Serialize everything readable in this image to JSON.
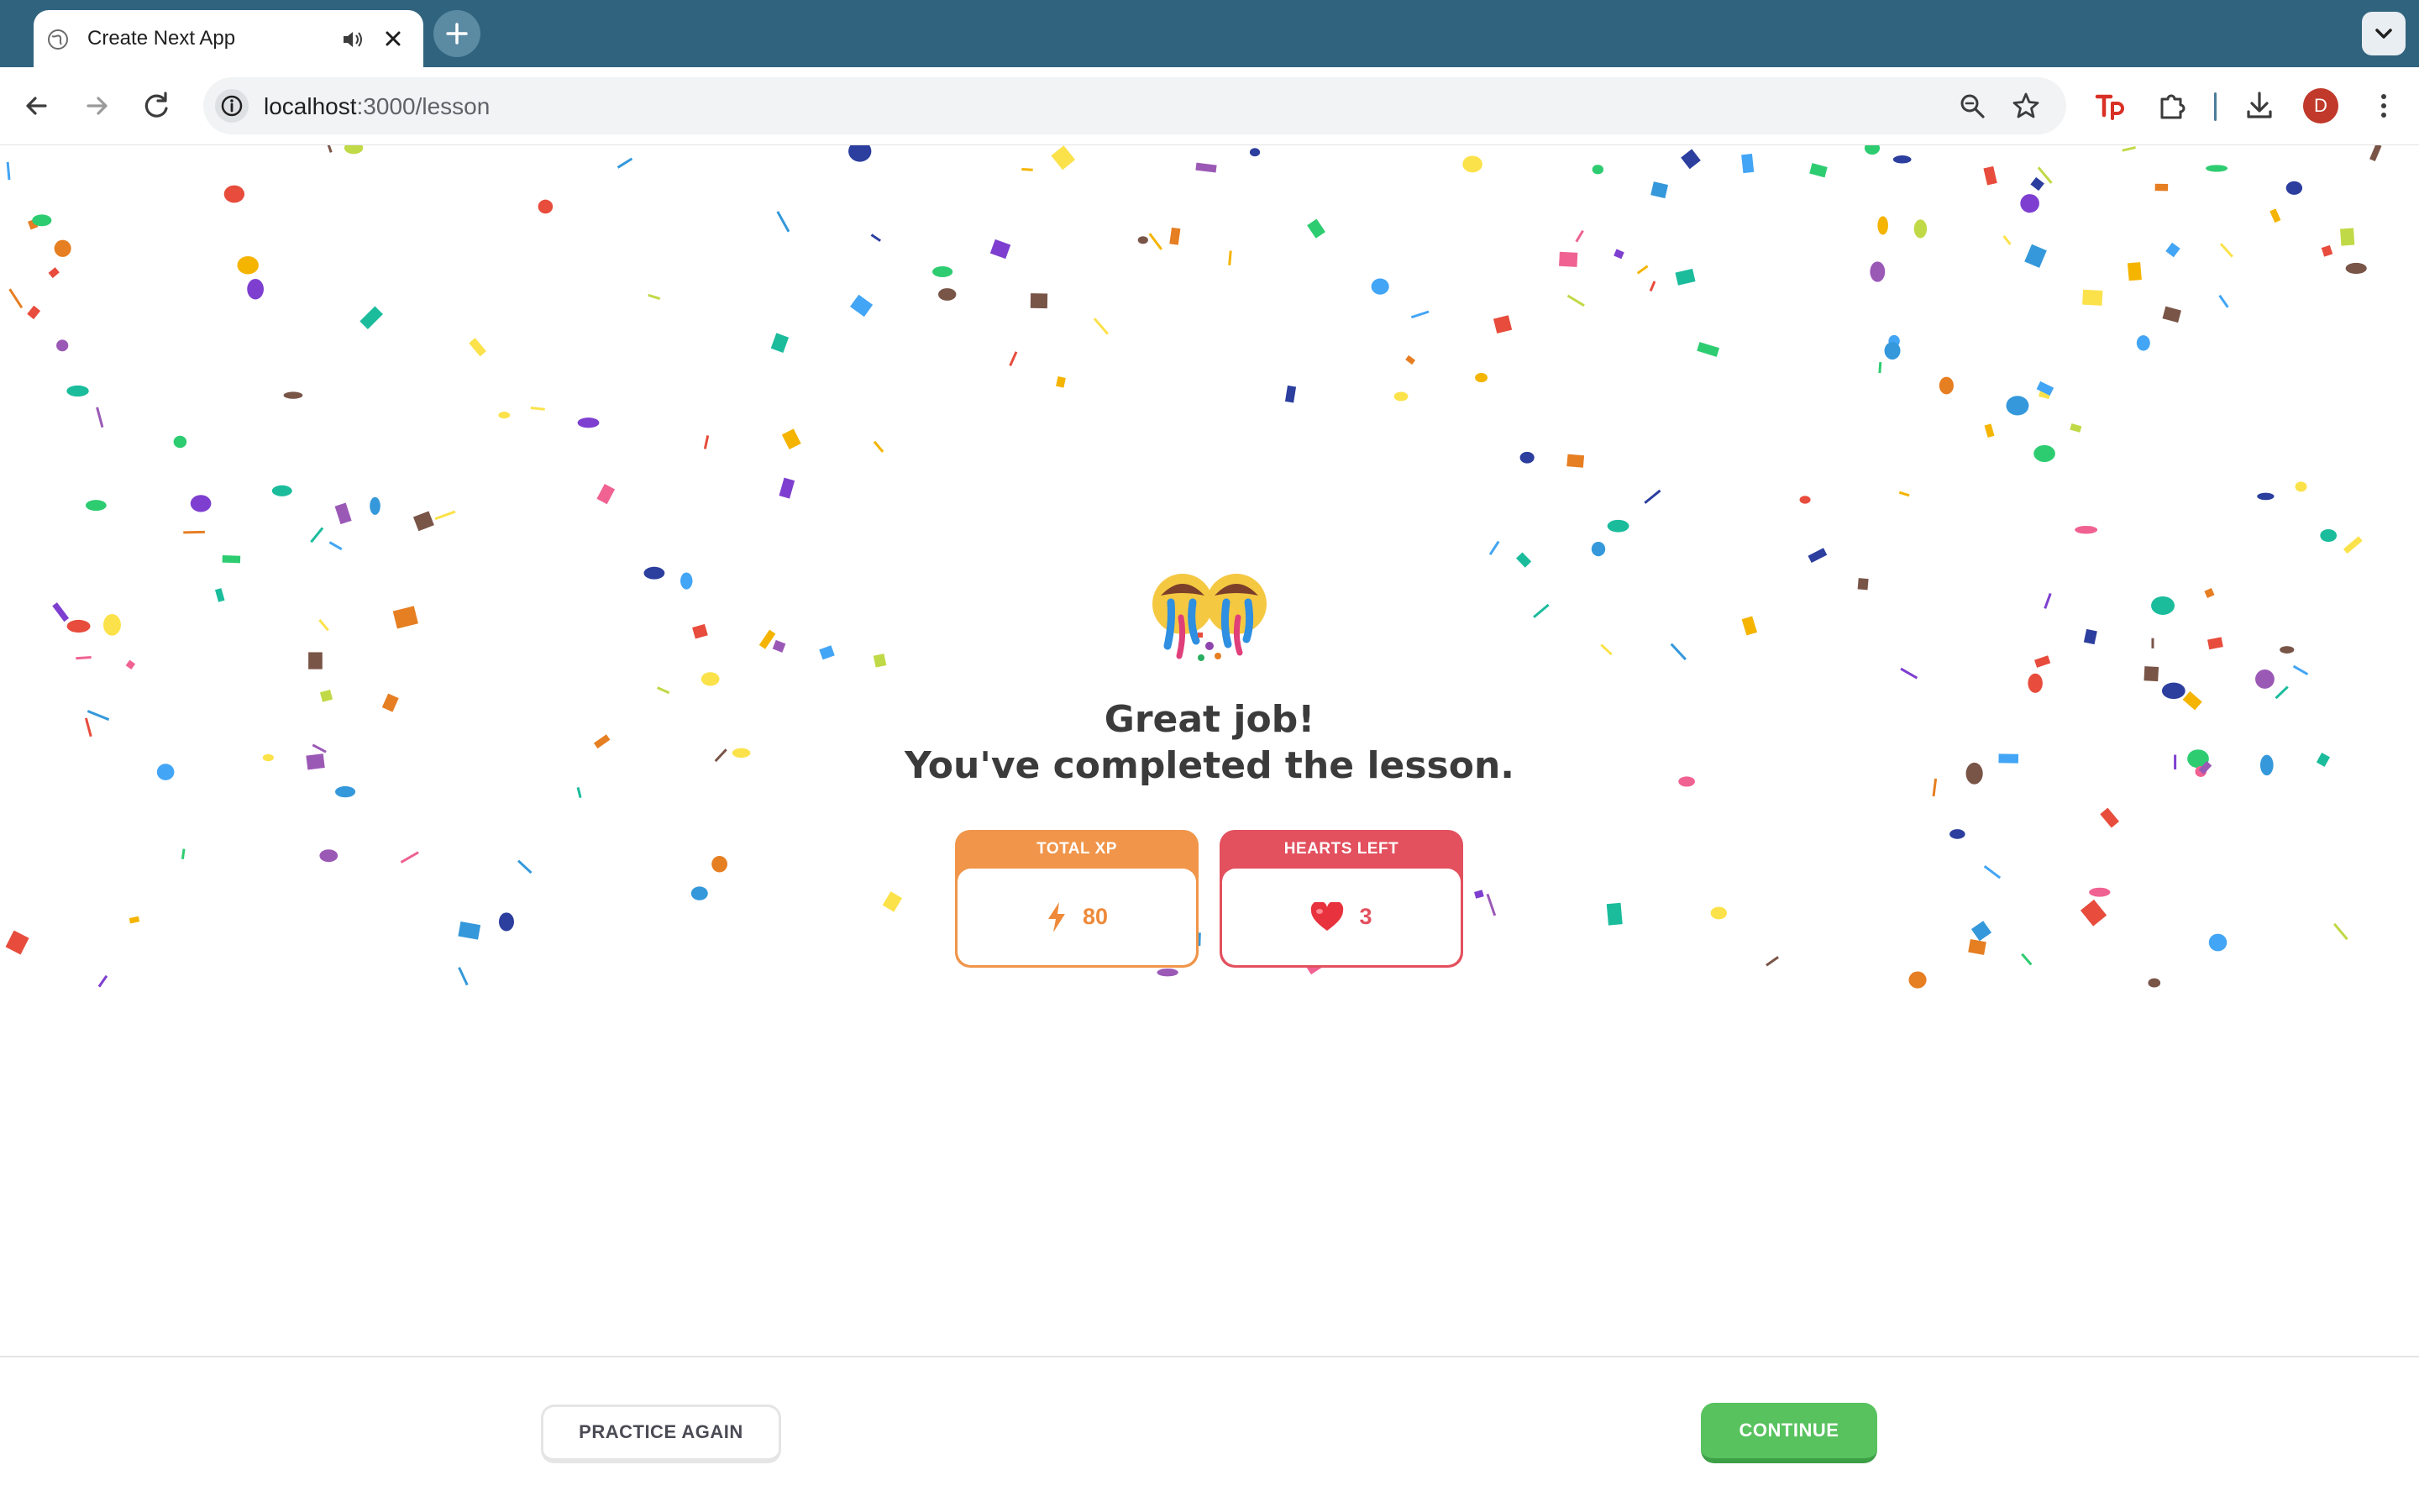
{
  "browser": {
    "tab_title": "Create Next App",
    "url_host": "localhost",
    "url_path": ":3000/lesson",
    "avatar_letter": "D",
    "colors": {
      "tabstrip": "#30637e",
      "avatar": "#c0392b"
    }
  },
  "lesson_complete": {
    "headline_line1": "Great job!",
    "headline_line2": "You've completed the lesson.",
    "stats": {
      "xp_label": "TOTAL XP",
      "xp_value": "80",
      "hearts_label": "HEARTS LEFT",
      "hearts_value": "3"
    },
    "mascot": "finish-mascot-icon"
  },
  "footer": {
    "practice_label": "PRACTICE AGAIN",
    "continue_label": "CONTINUE"
  },
  "theme": {
    "xp_orange": "#f0954a",
    "hearts_red": "#e3505e",
    "continue_green": "#58c25f"
  }
}
